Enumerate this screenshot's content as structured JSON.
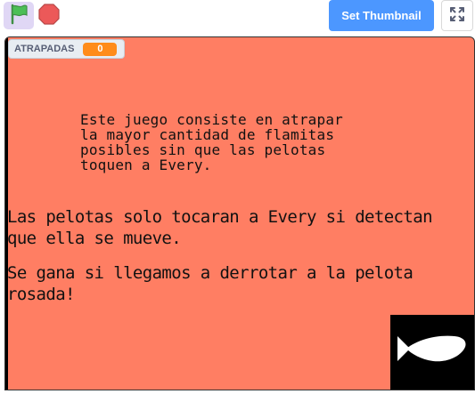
{
  "toolbar": {
    "green_flag_icon": "green-flag-icon",
    "stop_icon": "stop-sign-icon",
    "set_thumbnail_label": "Set Thumbnail",
    "fullscreen_icon": "fullscreen-icon"
  },
  "stage": {
    "background_color": "#ff7e63",
    "monitor": {
      "label": "ATRAPADAS",
      "value": "0"
    },
    "text_intro": "Este juego consiste en atrapar\nla mayor cantidad de flamitas\nposibles sin que las pelotas\ntoquen a Every.",
    "text_rule": "Las pelotas solo tocaran a Every si detectan\nque ella se mueve.",
    "text_win": "Se gana si llegamos a derrotar a la pelota\nrosada!",
    "sprite_icon": "fish-sprite-icon"
  },
  "colors": {
    "accent": "#4c97ff",
    "monitor_value": "#ff8c1a",
    "stop_red": "#e6453a",
    "flag_green": "#4cbf56"
  }
}
